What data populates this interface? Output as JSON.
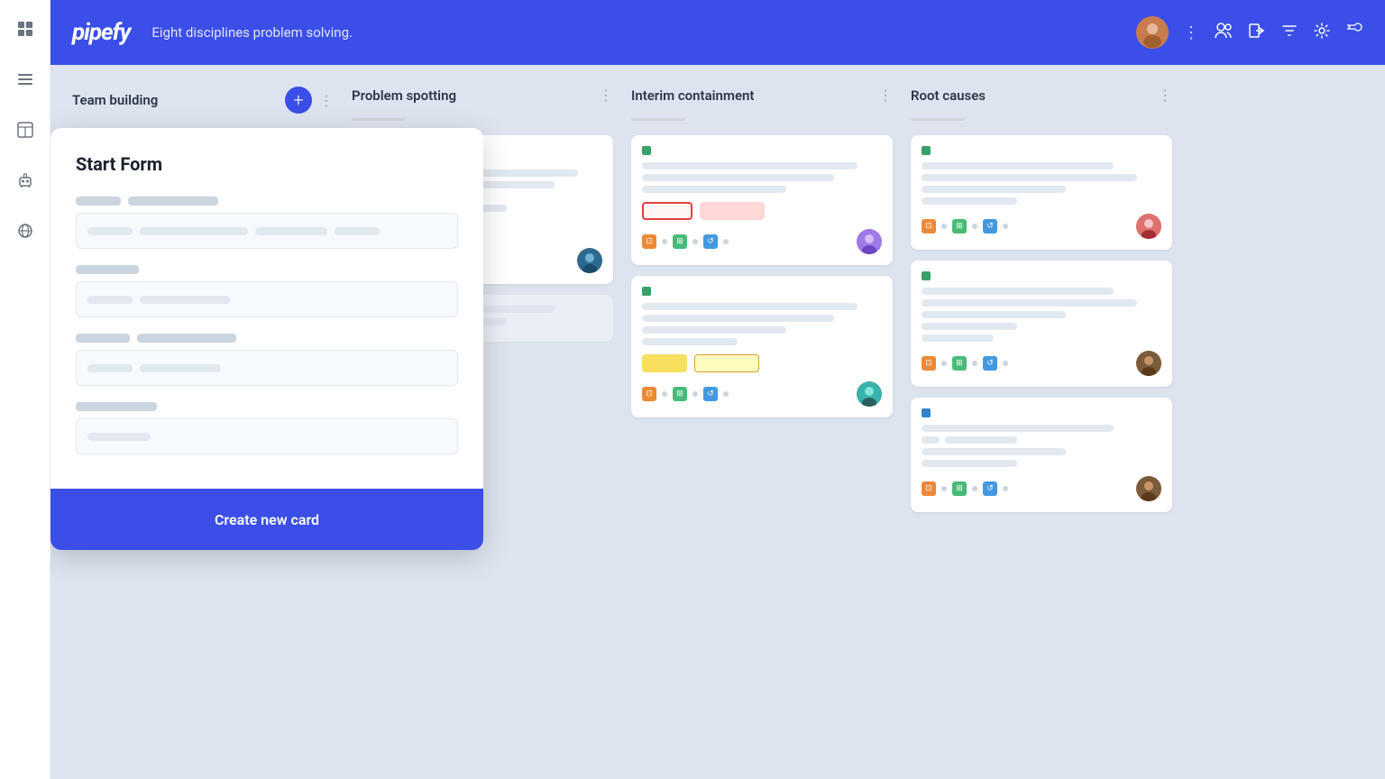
{
  "app": {
    "name": "pipefy",
    "subtitle": "Eight disciplines problem solving."
  },
  "header": {
    "title": "Eight disciplines problem solving.",
    "icons": [
      "people-icon",
      "login-icon",
      "filter-icon",
      "settings-icon",
      "wrench-icon",
      "more-icon"
    ]
  },
  "sidebar": {
    "items": [
      {
        "id": "grid",
        "icon": "⊞"
      },
      {
        "id": "list",
        "icon": "☰"
      },
      {
        "id": "table",
        "icon": "⊡"
      },
      {
        "id": "robot",
        "icon": "⚙"
      },
      {
        "id": "globe",
        "icon": "🌐"
      }
    ]
  },
  "board": {
    "columns": [
      {
        "id": "team-building",
        "title": "Team building",
        "has_add": true
      },
      {
        "id": "problem-spotting",
        "title": "Problem spotting",
        "has_add": false
      },
      {
        "id": "interim-containment",
        "title": "Interim containment",
        "has_add": false
      },
      {
        "id": "root-causes",
        "title": "Root causes",
        "has_add": false
      }
    ]
  },
  "start_form": {
    "title": "Start Form",
    "fields": [
      {
        "label_width1": 50,
        "label_width2": 100,
        "input_bars": [
          50,
          120,
          80,
          50
        ]
      },
      {
        "label_width1": 70,
        "label_width2": 0,
        "input_bars": [
          50,
          100
        ]
      },
      {
        "label_width1": 60,
        "label_width2": 110,
        "input_bars": [
          50,
          90
        ]
      },
      {
        "label_width1": 90,
        "label_width2": 0,
        "input_bars": [
          70
        ]
      }
    ],
    "button_label": "Create new card",
    "colors": {
      "button_bg": "#3B4EE8"
    }
  }
}
